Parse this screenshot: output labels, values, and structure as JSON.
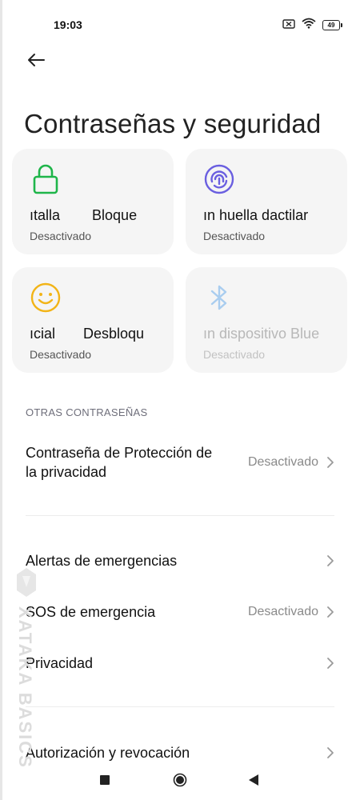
{
  "status_bar": {
    "time": "19:03",
    "battery_level": "49",
    "icons": [
      "no-sim-icon",
      "wifi-icon",
      "battery-icon"
    ]
  },
  "header": {
    "back_icon": "arrow-left-icon",
    "title": "Contraseñas y seguridad"
  },
  "cards": [
    {
      "title": "ıtalla        Bloque",
      "status": "Desactivado",
      "icon": "lock-icon",
      "icon_color": "#1fb54a",
      "enabled": true
    },
    {
      "title": "ın huella dactilar",
      "status": "Desactivado",
      "icon": "fingerprint-icon",
      "icon_color": "#6a5fe0",
      "enabled": true
    },
    {
      "title": "ıcial       Desbloqu",
      "status": "Desactivado",
      "icon": "smiley-face-icon",
      "icon_color": "#f2b417",
      "enabled": true
    },
    {
      "title": "ın dispositivo Blue",
      "status": "Desactivado",
      "icon": "bluetooth-icon",
      "icon_color": "#a9cdef",
      "enabled": false
    }
  ],
  "section": {
    "other_passwords": "OTRAS CONTRASEÑAS"
  },
  "rows": {
    "privacy_protection": {
      "label_line1": "Contraseña de Protección de",
      "label_line2": "la privacidad",
      "value": "Desactivado"
    },
    "emergency_alerts": {
      "label": "Alertas de emergencias"
    },
    "emergency_sos": {
      "label": "SOS de emergencia",
      "value": "Desactivado"
    },
    "privacy": {
      "label": "Privacidad"
    },
    "authorization": {
      "label": "Autorización y revocación"
    }
  },
  "watermark": {
    "text": "XATAKA BASICS"
  },
  "colors": {
    "accent_green": "#1fb54a",
    "accent_purple": "#6a5fe0",
    "accent_yellow": "#f2b417",
    "bluetooth_disabled": "#a9cdef",
    "card_background": "#f5f5f5"
  },
  "nav": {
    "icons": [
      "recents-square-icon",
      "home-circle-icon",
      "back-triangle-icon"
    ]
  }
}
